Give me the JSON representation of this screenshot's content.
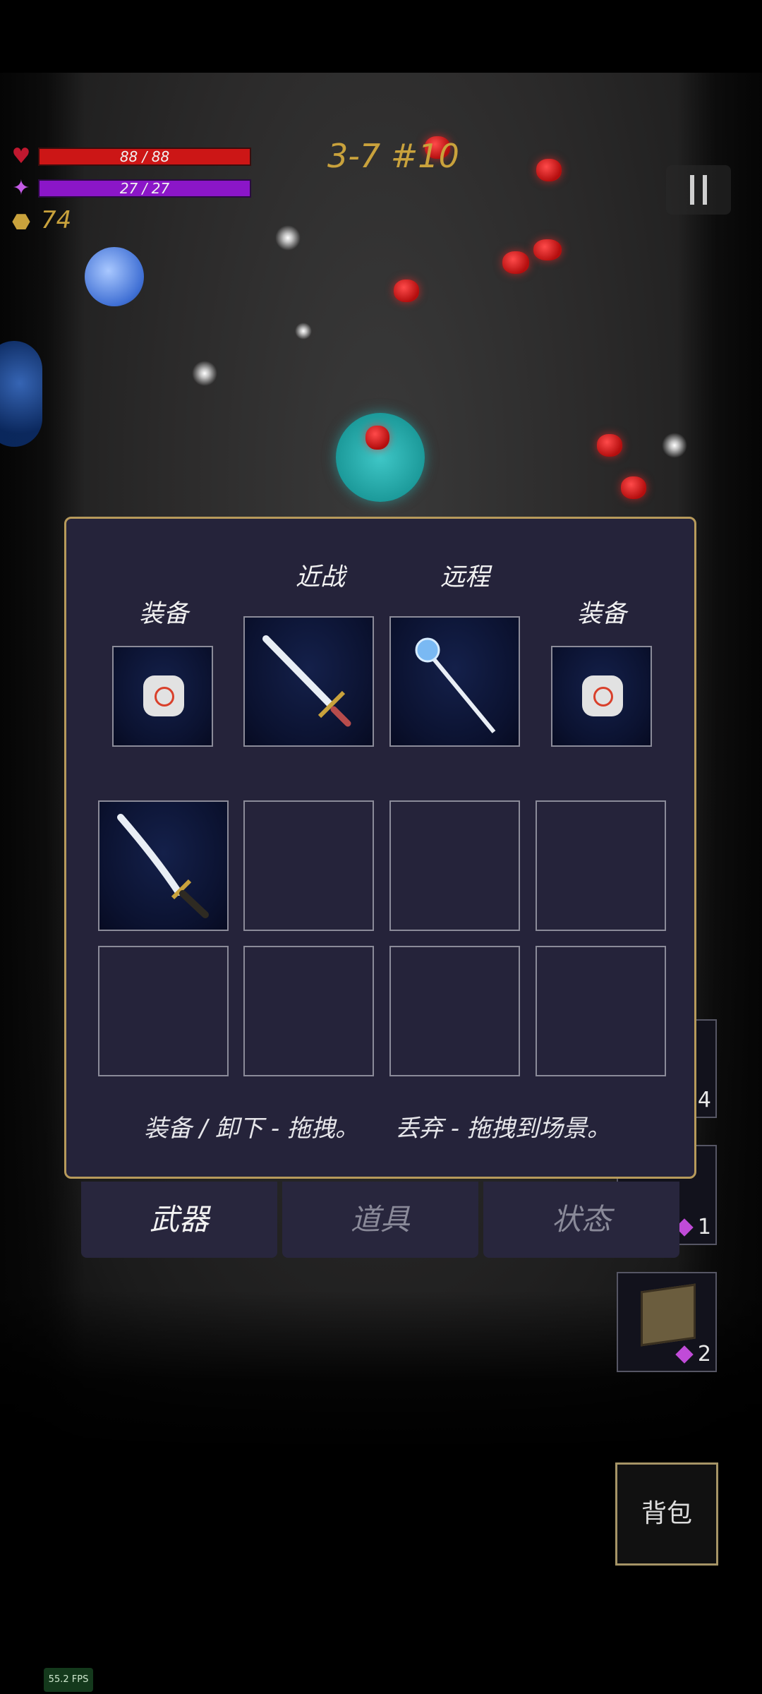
{
  "hud": {
    "hp_text": "88 / 88",
    "hp_fraction": 1.0,
    "mp_text": "27 / 27",
    "mp_fraction": 1.0,
    "gold": "74",
    "level": "3-7 #10",
    "pause_icon": "pause-icon",
    "colors": {
      "hp": "#cc1616",
      "mp": "#8b16c8",
      "gold": "#c9a23c",
      "level": "#c9a23c"
    }
  },
  "equipment_panel": {
    "melee_label": "近战",
    "ranged_label": "远程",
    "equip_left_label": "装备",
    "equip_right_label": "装备",
    "equip_left_icon": "rune-stone-icon",
    "melee_icon": "sword-icon",
    "ranged_icon": "magic-staff-icon",
    "equip_right_icon": "rune-stone-icon",
    "inventory": [
      {
        "icon": "katana-icon"
      },
      {
        "icon": ""
      },
      {
        "icon": ""
      },
      {
        "icon": ""
      },
      {
        "icon": ""
      },
      {
        "icon": ""
      },
      {
        "icon": ""
      },
      {
        "icon": ""
      }
    ],
    "hint_equip": "装备 / 卸下 - 拖拽。",
    "hint_discard": "丢弃 - 拖拽到场景。"
  },
  "tabs": [
    {
      "label": "武器",
      "active": true
    },
    {
      "label": "道具",
      "active": false
    },
    {
      "label": "状态",
      "active": false
    }
  ],
  "side_cards": [
    {
      "count": "4"
    },
    {
      "count": "1"
    },
    {
      "count": "2",
      "icon": "rune-cube-icon"
    }
  ],
  "bag_button": "背包",
  "fps": "55.2 FPS"
}
